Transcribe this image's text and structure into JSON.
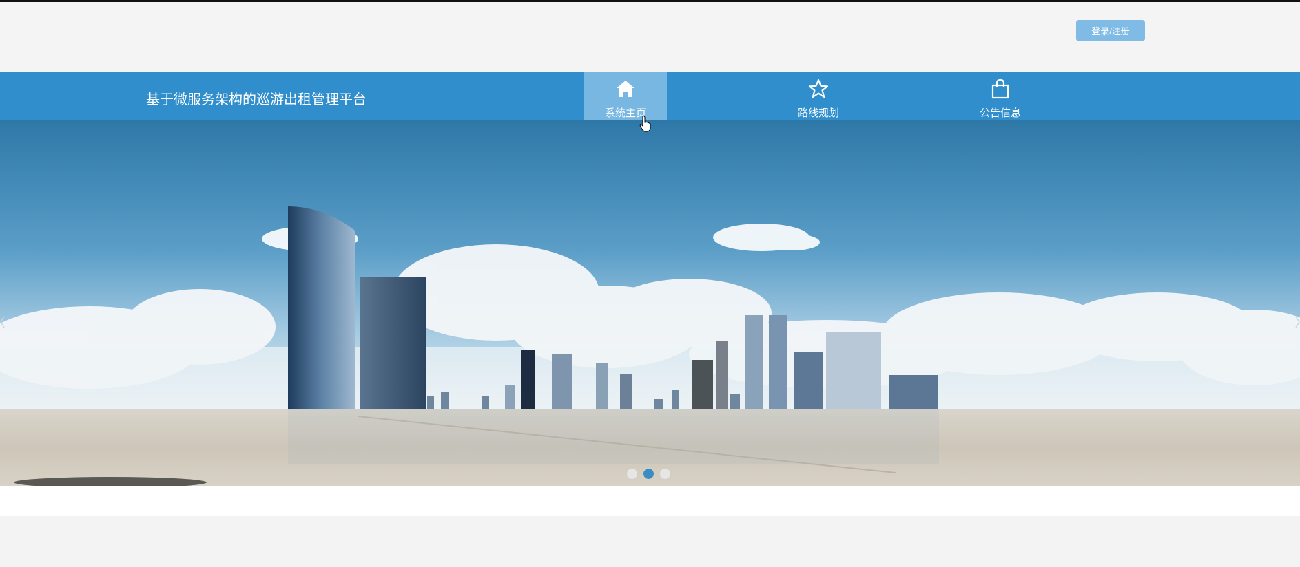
{
  "header": {
    "login_label": "登录/注册"
  },
  "nav": {
    "site_title": "基于微服务架构的巡游出租管理平台",
    "items": [
      {
        "label": "系统主页",
        "icon": "home-icon",
        "active": true
      },
      {
        "label": "路线规划",
        "icon": "star-icon",
        "active": false
      },
      {
        "label": "公告信息",
        "icon": "shopping-bag-icon",
        "active": false
      }
    ]
  },
  "carousel": {
    "slide_count": 3,
    "active_index": 1
  },
  "colors": {
    "nav_bg": "#2f8ecb",
    "nav_active_bg": "#78b7e1",
    "login_bg": "#7fbbe4",
    "dot_active": "#3a8cc4"
  }
}
